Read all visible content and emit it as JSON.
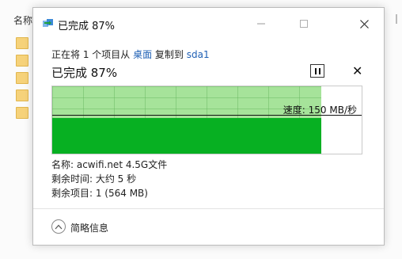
{
  "background": {
    "column_header": "名称"
  },
  "dialog": {
    "title": "已完成 87%",
    "line1_prefix": "正在将 1 个项目从 ",
    "from": "桌面",
    "line1_mid": " 复制到 ",
    "to": "sda1",
    "progress_label": "已完成 87%",
    "progress_fraction": 0.87,
    "speed_label": "速度: 150 MB/秒",
    "name_line": "名称: acwifi.net 4.5G文件",
    "time_line": "剩余时间: 大约 5 秒",
    "items_line": "剩余项目: 1 (564 MB)",
    "details_label": "简略信息",
    "colors": {
      "bar_light": "#a6e39a",
      "bar_dark": "#07b022",
      "link": "#1e5fb4"
    }
  }
}
